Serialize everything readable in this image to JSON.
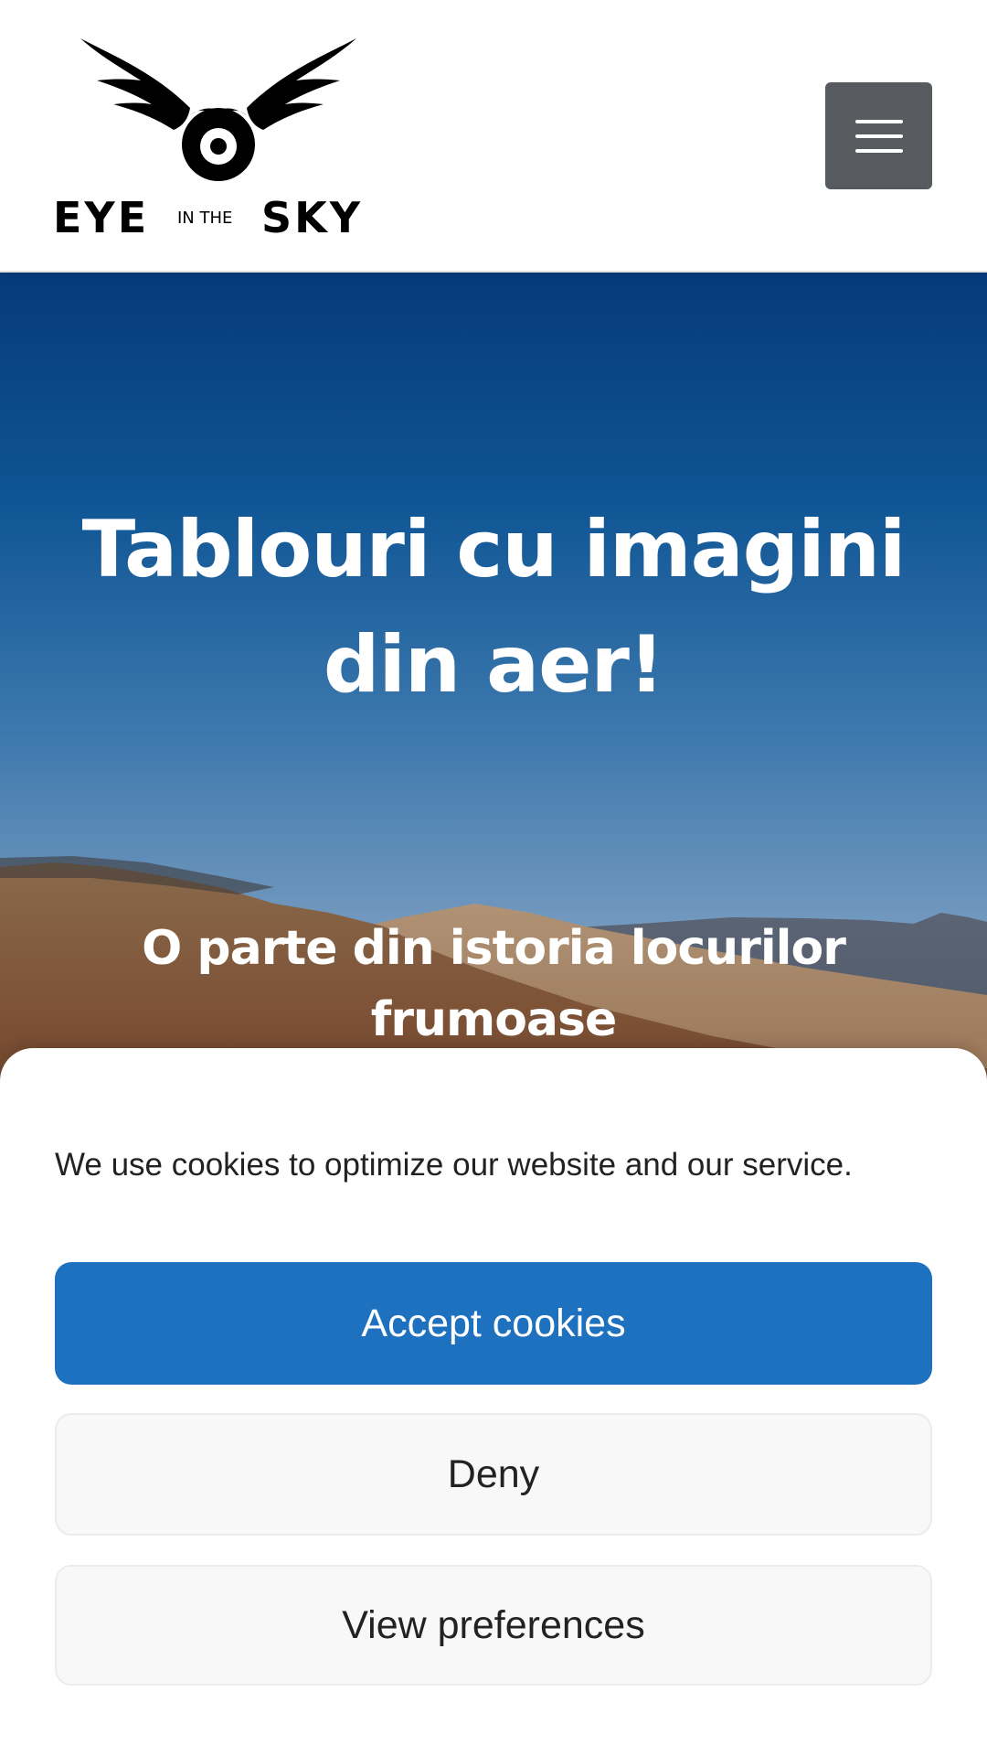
{
  "header": {
    "logo_text_left": "EYE",
    "logo_text_mid": "IN THE",
    "logo_text_right": "SKY",
    "menu_icon": "hamburger-menu-icon"
  },
  "hero": {
    "title": "Tablouri cu imagini din aer!",
    "subtitle": "O parte din istoria locurilor frumoase"
  },
  "cookie_banner": {
    "message": "We use cookies to optimize our website and our service.",
    "accept_label": "Accept cookies",
    "deny_label": "Deny",
    "preferences_label": "View preferences"
  },
  "colors": {
    "accent": "#1e71be",
    "menu_button": "#575b5f"
  }
}
